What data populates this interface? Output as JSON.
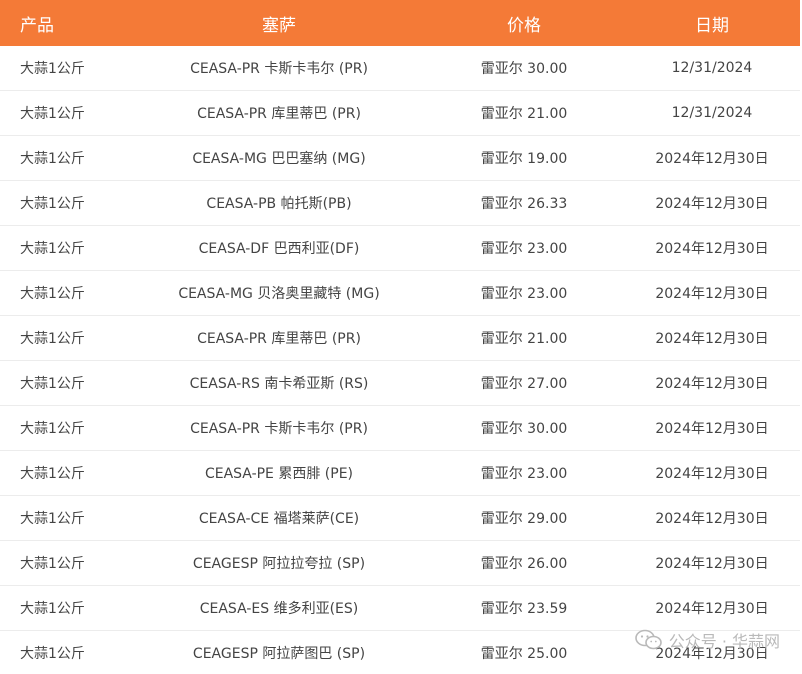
{
  "table": {
    "headers": [
      "产品",
      "塞萨",
      "价格",
      "日期"
    ],
    "rows": [
      [
        "大蒜1公斤",
        "CEASA-PR 卡斯卡韦尔 (PR)",
        "雷亚尔 30.00",
        "12/31/2024"
      ],
      [
        "大蒜1公斤",
        "CEASA-PR 库里蒂巴 (PR)",
        "雷亚尔 21.00",
        "12/31/2024"
      ],
      [
        "大蒜1公斤",
        "CEASA-MG 巴巴塞纳 (MG)",
        "雷亚尔 19.00",
        "2024年12月30日"
      ],
      [
        "大蒜1公斤",
        "CEASA-PB 帕托斯(PB)",
        "雷亚尔 26.33",
        "2024年12月30日"
      ],
      [
        "大蒜1公斤",
        "CEASA-DF 巴西利亚(DF)",
        "雷亚尔 23.00",
        "2024年12月30日"
      ],
      [
        "大蒜1公斤",
        "CEASA-MG 贝洛奥里藏特 (MG)",
        "雷亚尔 23.00",
        "2024年12月30日"
      ],
      [
        "大蒜1公斤",
        "CEASA-PR 库里蒂巴 (PR)",
        "雷亚尔 21.00",
        "2024年12月30日"
      ],
      [
        "大蒜1公斤",
        "CEASA-RS 南卡希亚斯 (RS)",
        "雷亚尔 27.00",
        "2024年12月30日"
      ],
      [
        "大蒜1公斤",
        "CEASA-PR 卡斯卡韦尔 (PR)",
        "雷亚尔 30.00",
        "2024年12月30日"
      ],
      [
        "大蒜1公斤",
        "CEASA-PE 累西腓 (PE)",
        "雷亚尔 23.00",
        "2024年12月30日"
      ],
      [
        "大蒜1公斤",
        "CEASA-CE 福塔莱萨(CE)",
        "雷亚尔 29.00",
        "2024年12月30日"
      ],
      [
        "大蒜1公斤",
        "CEAGESP 阿拉拉夸拉 (SP)",
        "雷亚尔 26.00",
        "2024年12月30日"
      ],
      [
        "大蒜1公斤",
        "CEASA-ES 维多利亚(ES)",
        "雷亚尔 23.59",
        "2024年12月30日"
      ],
      [
        "大蒜1公斤",
        "CEAGESP 阿拉萨图巴 (SP)",
        "雷亚尔 25.00",
        "2024年12月30日"
      ]
    ]
  },
  "watermark": {
    "text": "公众号 · 华蒜网",
    "icon": "wechat-icon"
  },
  "colors": {
    "header_bg": "#f47a37",
    "header_text": "#ffffff",
    "row_border": "#ececec",
    "body_text": "#444444"
  }
}
